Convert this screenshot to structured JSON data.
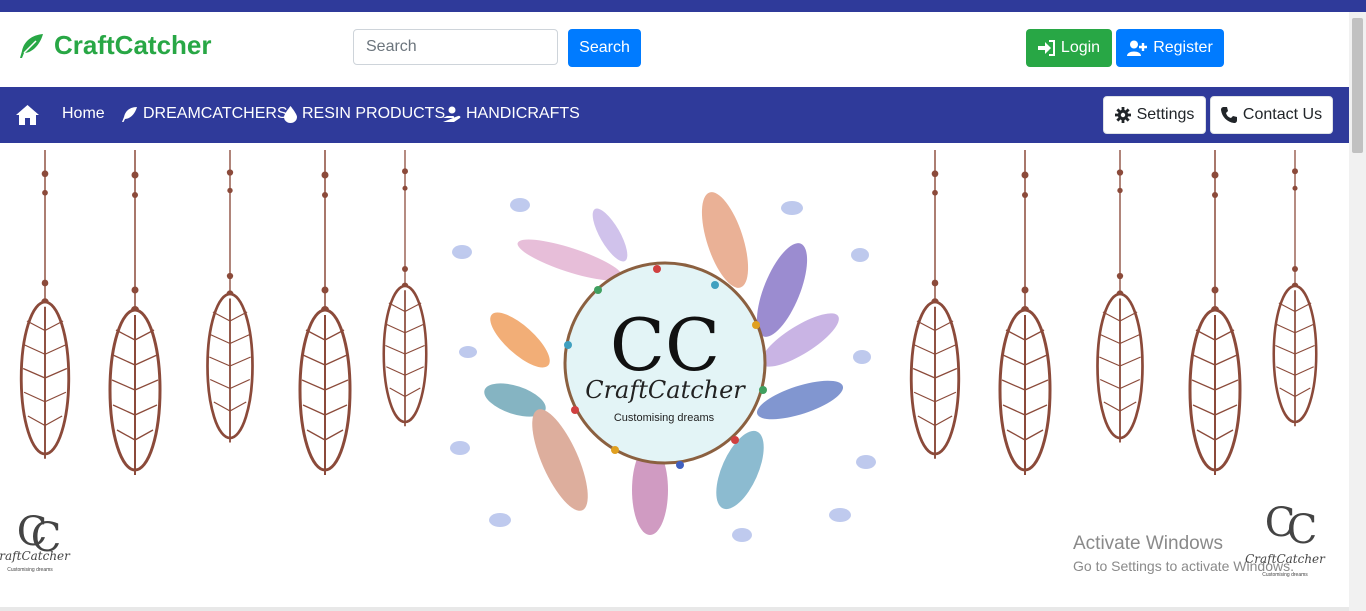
{
  "brand": {
    "name": "CraftCatcher",
    "color": "#28a745",
    "icon": "feather-icon"
  },
  "search": {
    "placeholder": "Search",
    "button_label": "Search"
  },
  "auth": {
    "login_label": "Login",
    "register_label": "Register"
  },
  "nav": {
    "home_icon": "home-icon",
    "items": [
      {
        "label": "Home"
      },
      {
        "label": "DREAMCATCHERS",
        "icon": "feather-icon"
      },
      {
        "label": "RESIN PRODUCTS",
        "icon": "drop-icon"
      },
      {
        "label": "HANDICRAFTS",
        "icon": "hand-holding-icon"
      }
    ],
    "settings_label": "Settings",
    "contact_label": "Contact Us"
  },
  "hero": {
    "logo_initials": "CC",
    "logo_script": "CraftCatcher",
    "tagline": "Customising dreams",
    "corner_logo_script": "CraftCatcher",
    "corner_tagline": "Customising dreams"
  },
  "watermark": {
    "title": "Activate Windows",
    "subtitle": "Go to Settings to activate Windows."
  },
  "colors": {
    "navbar": "#2f3a9a",
    "primary": "#007bff",
    "success": "#28a745",
    "feather": "#8b4a3a"
  }
}
